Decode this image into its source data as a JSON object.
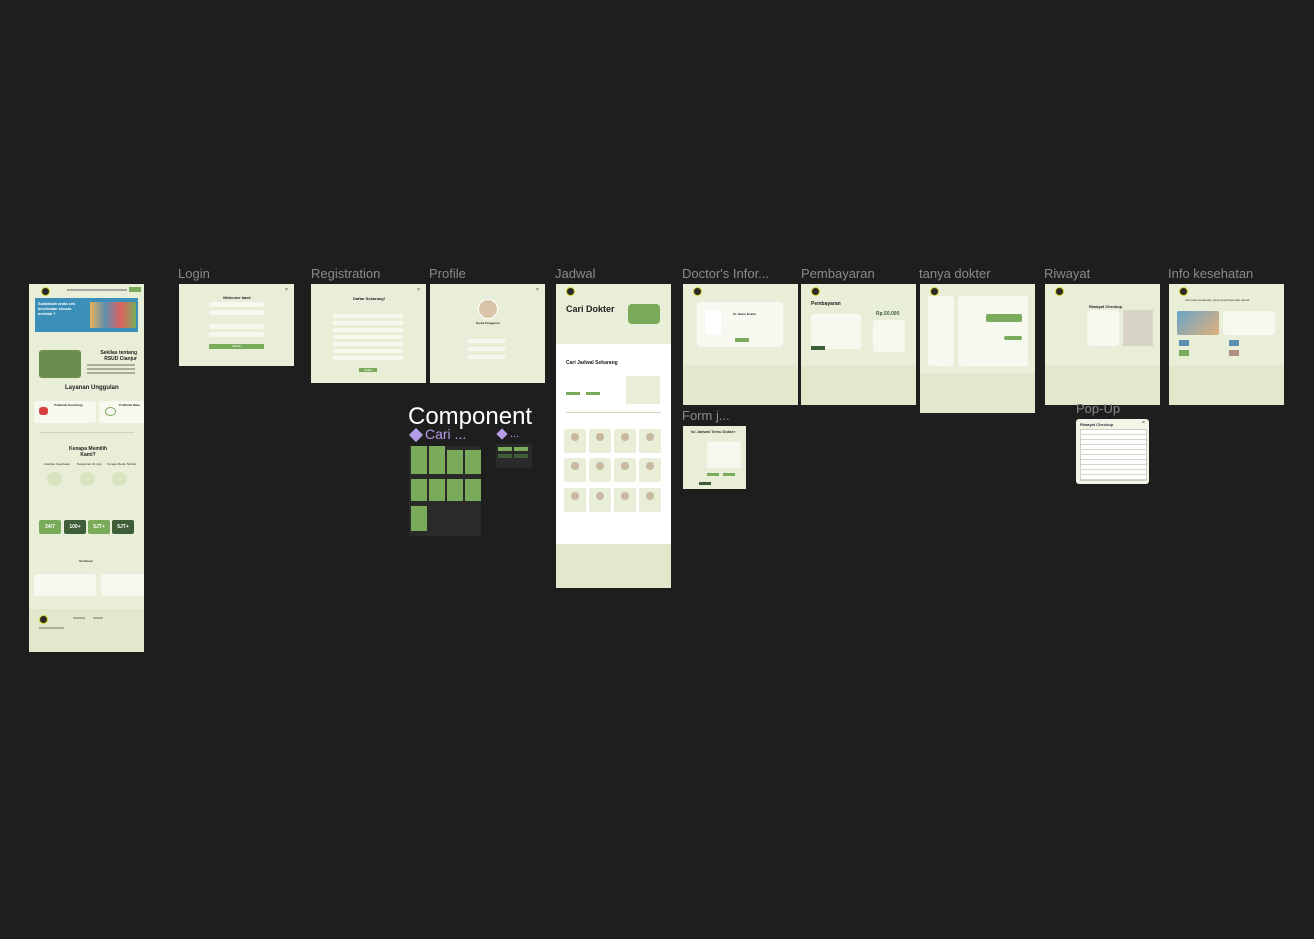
{
  "frames": {
    "login": "Login",
    "registration": "Registration",
    "profile": "Profile",
    "jadwal": "Jadwal",
    "doctors_info": "Doctor's Infor...",
    "pembayaran": "Pembayaran",
    "tanya_dokter": "tanya dokter",
    "riwayat": "Riwayat",
    "info_kesehatan": "Info kesehatan",
    "form": "Form j...",
    "popup": "Pop-Up"
  },
  "component": {
    "title": "Component",
    "cari": "Cari ...",
    "more": "..."
  },
  "home": {
    "hero_text": "Sudahkah anda cek kesehatan secara berkala ?",
    "about_title": "Sekilas tentang RSUD Cianjur",
    "layanan_title": "Layanan Unggulan",
    "layanan_1": "Poliklinik Kardiologi",
    "layanan_2": "Poliklinik Mata",
    "why_title": "Kenapa Memilih Kami?",
    "feature_1": "Fasilitas Kesehatan",
    "feature_2": "Pelayanan 24 Jam",
    "feature_3": "Tenaga Medis Terbaik",
    "stats": [
      "24/7",
      "100+",
      "5JT+",
      "5JT+"
    ],
    "testimoni": "Testimoni"
  },
  "login": {
    "title": "Welcome back",
    "button": "Masuk"
  },
  "registration": {
    "title": "Daftar Sekarang!",
    "button": "Daftar"
  },
  "profile": {
    "name": "Nama Pengguna"
  },
  "jadwal": {
    "title": "Cari Dokter",
    "section": "Cari Jadwal Sekarang"
  },
  "doctor": {
    "title": "Dr. Nama Dokter"
  },
  "pembayaran": {
    "title": "Pembayaran",
    "amount": "Rp.50.000"
  },
  "riwayat": {
    "title": "Riwayat Checkup"
  },
  "info": {
    "title": "Informasi kesehatan yang terpercaya dan akurat"
  },
  "form": {
    "title": "Isi Jadwal Temu Dokter"
  },
  "popup": {
    "title": "Riwayat Checkup"
  },
  "colors": {
    "canvas": "#1e1e1e",
    "frame_bg": "#e9eed8",
    "accent": "#7aab5a",
    "dark_green": "#3f5e37",
    "component_purple": "#b59ce8"
  }
}
